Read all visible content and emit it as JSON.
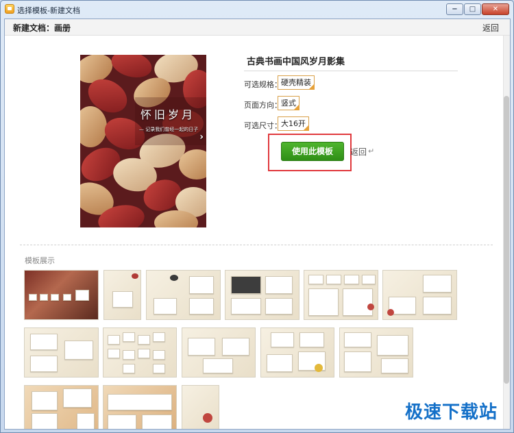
{
  "window": {
    "title": "选择模板-新建文档"
  },
  "window_controls": {
    "minimize": "−",
    "maximize": "□",
    "close": "✕"
  },
  "header": {
    "title": "新建文档：画册",
    "back_label": "返回"
  },
  "cover": {
    "title": "怀旧岁月",
    "subtitle": "— 记录我们曾经一起的日子"
  },
  "template": {
    "name": "古典书画中国风岁月影集",
    "options": [
      {
        "label": "可选规格：",
        "value": "硬壳精装"
      },
      {
        "label": "页面方向：",
        "value": "竖式"
      },
      {
        "label": "可选尺寸：",
        "value": "大16开"
      }
    ],
    "use_button": "使用此模板",
    "back_label": "返回"
  },
  "gallery": {
    "label": "模板展示"
  },
  "watermark": "极速下载站",
  "colors": {
    "accent_green": "#3aa01f",
    "highlight_red": "#e0383c",
    "option_orange": "#e6a13a"
  }
}
